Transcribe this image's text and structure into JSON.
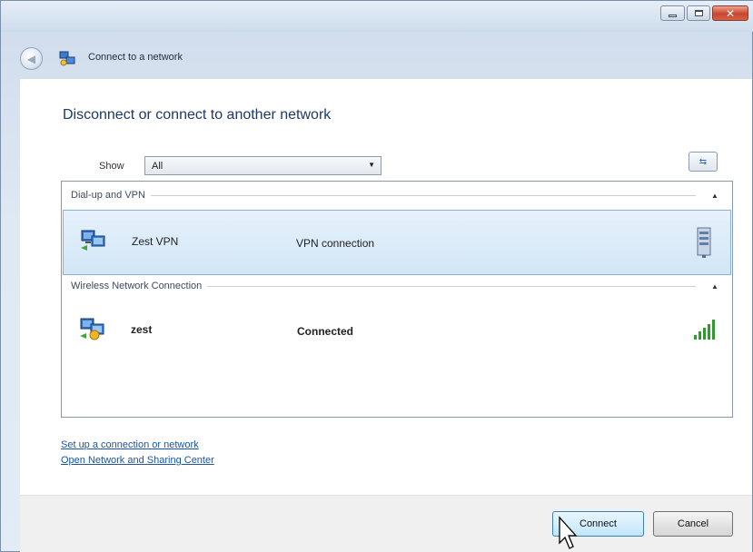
{
  "window": {
    "title": "Connect to a network",
    "controls": {
      "minimize": "minimize",
      "maximize": "maximize",
      "close": "close"
    }
  },
  "main": {
    "heading": "Disconnect or connect to another network",
    "show_label": "Show",
    "show_value": "All"
  },
  "groups": [
    {
      "title": "Dial-up and VPN",
      "items": [
        {
          "name": "Zest VPN",
          "status": "VPN connection",
          "icon": "vpn-network-icon",
          "right_icon": "vpn-server-icon",
          "selected": true
        }
      ]
    },
    {
      "title": "Wireless Network Connection",
      "items": [
        {
          "name": "zest",
          "status": "Connected",
          "icon": "wireless-network-icon",
          "right_icon": "signal-strength-icon",
          "signal_bars": 5,
          "selected": false
        }
      ]
    }
  ],
  "links": {
    "setup": "Set up a connection or network",
    "sharing_center": "Open Network and Sharing Center"
  },
  "buttons": {
    "connect": "Connect",
    "cancel": "Cancel"
  },
  "colors": {
    "heading": "#1e3966",
    "link": "#1a55a6",
    "selection": "#d2e6f7"
  }
}
